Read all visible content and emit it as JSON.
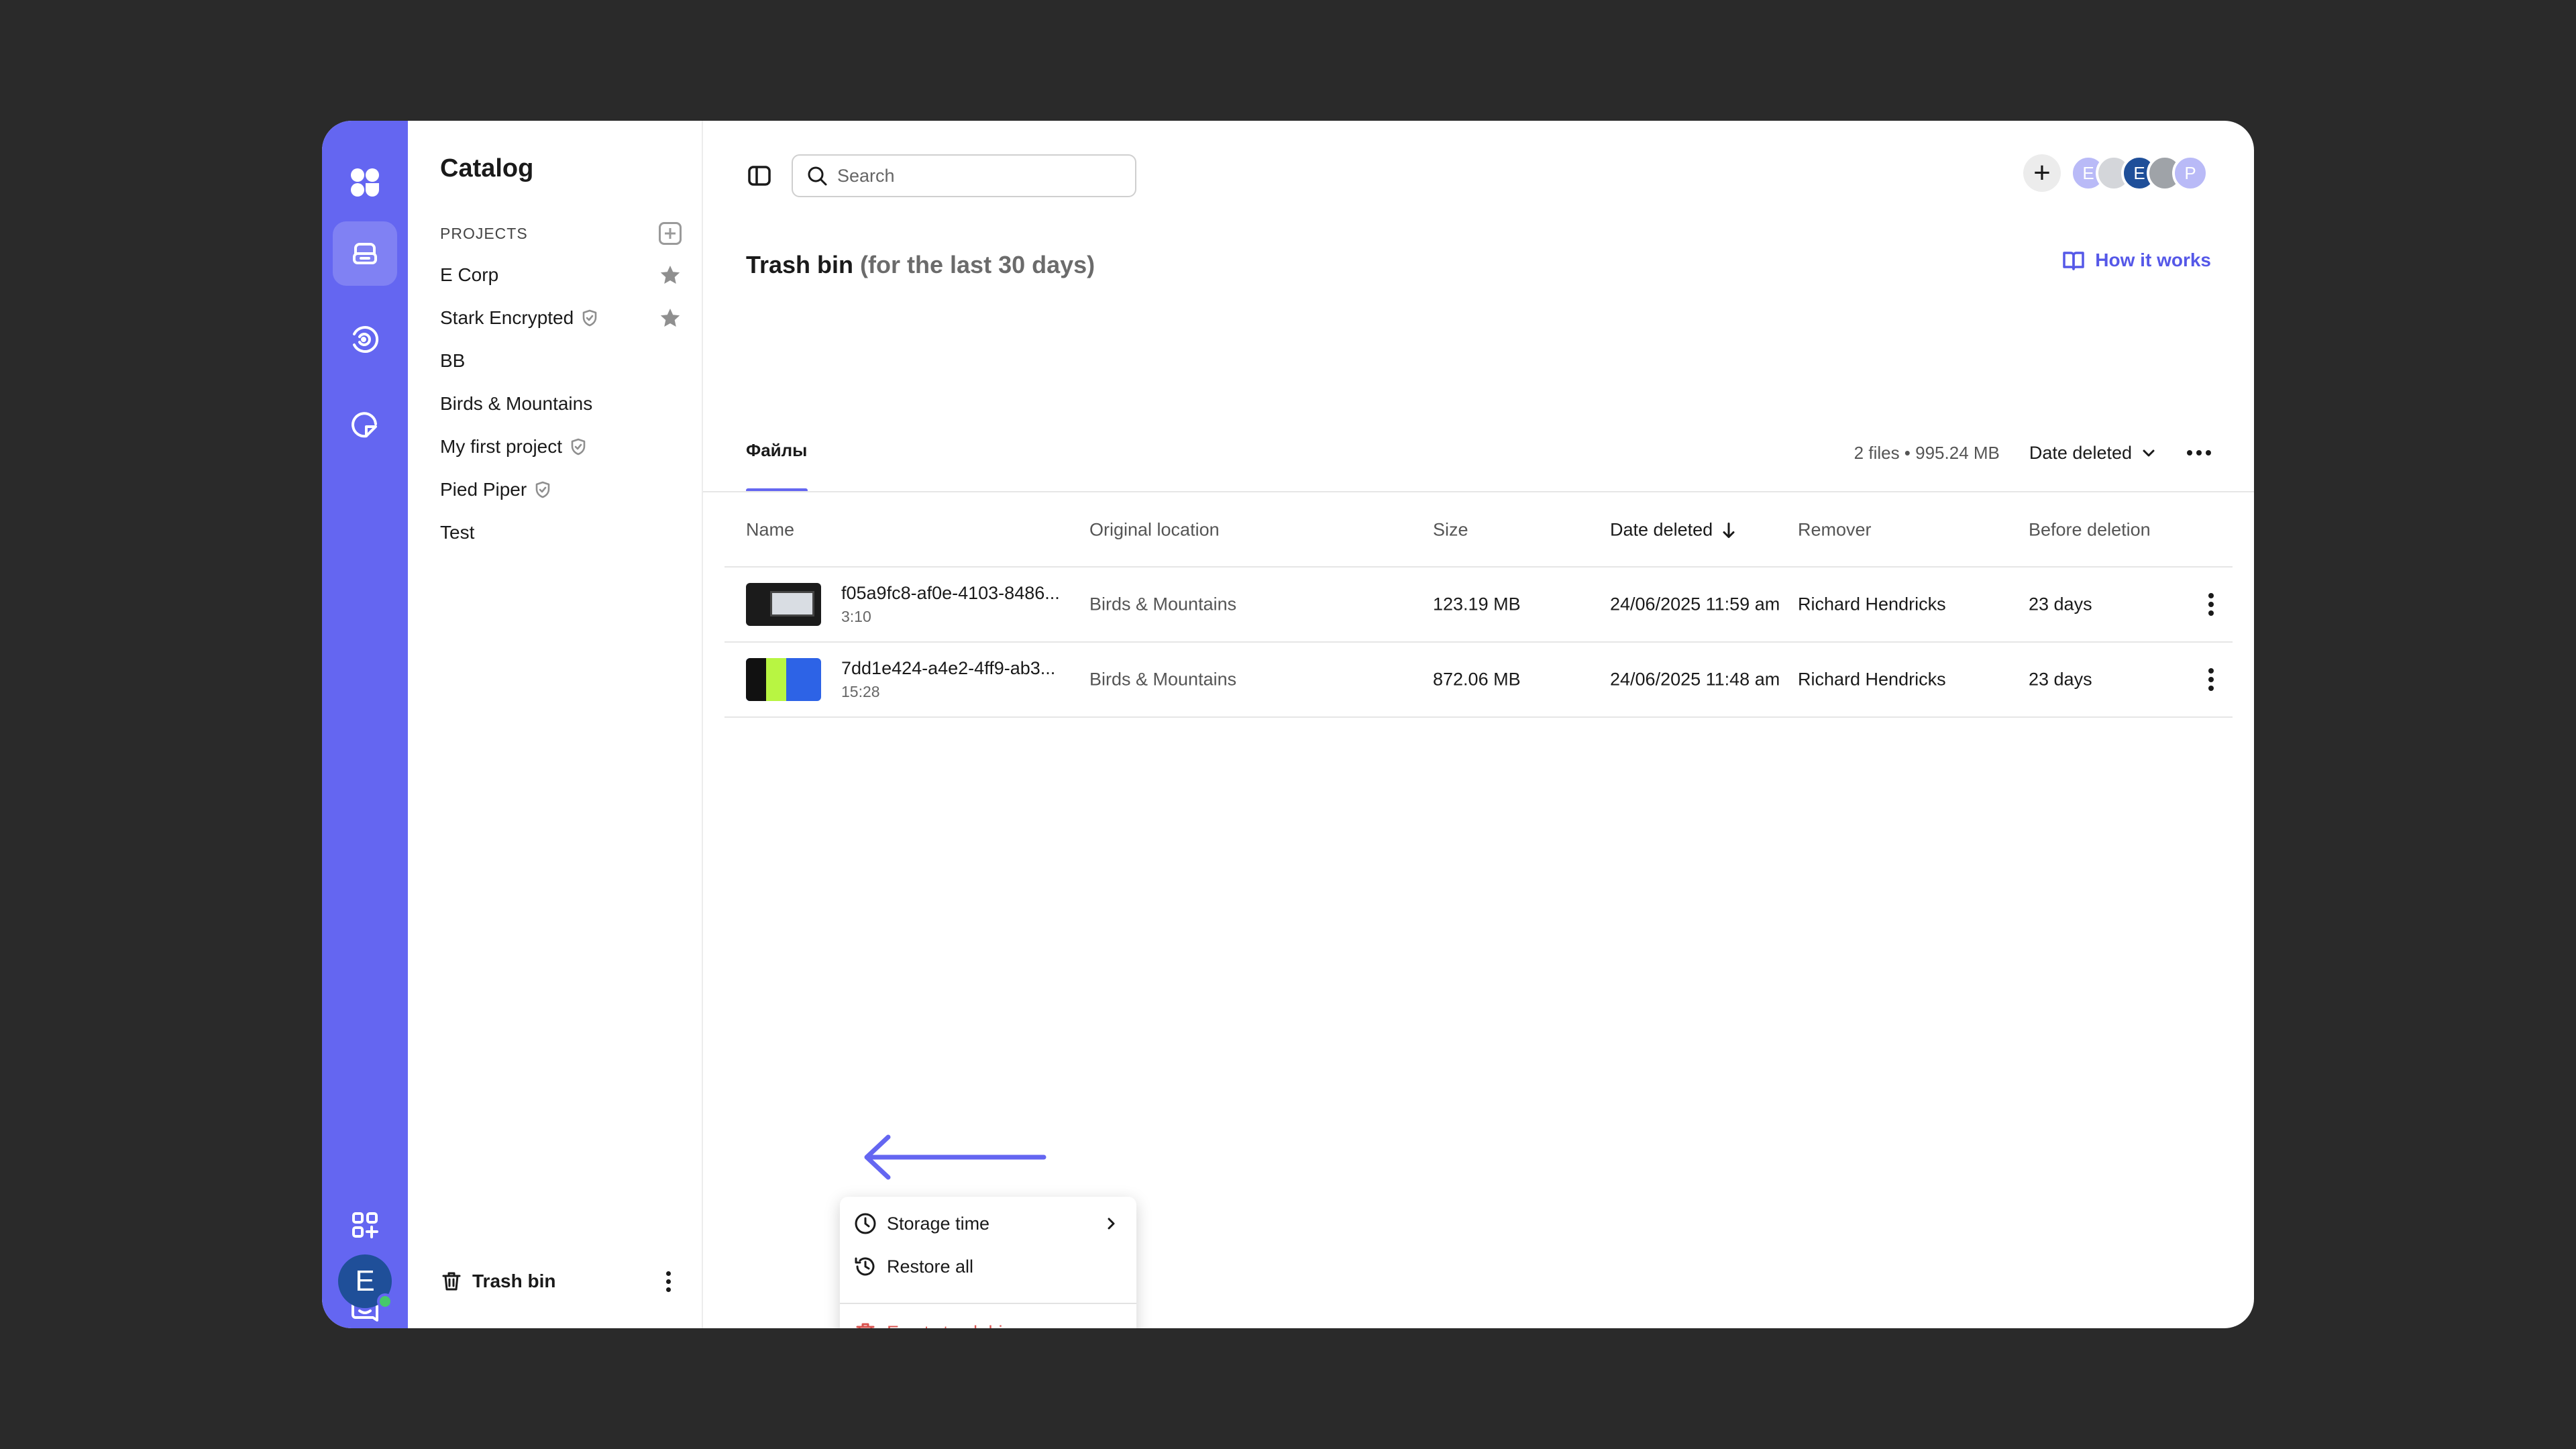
{
  "colors": {
    "accent": "#6466f1",
    "link": "#5558e8",
    "danger": "#d9534f",
    "backdrop": "#2a2a2a"
  },
  "rail": {
    "items": [
      {
        "name": "logo",
        "icon": "app-logo-icon"
      },
      {
        "name": "catalog",
        "icon": "storage-icon",
        "active": true
      },
      {
        "name": "broadcast",
        "icon": "stream-icon"
      },
      {
        "name": "review",
        "icon": "review-icon"
      },
      {
        "name": "apps",
        "icon": "apps-add-icon"
      },
      {
        "name": "messages",
        "icon": "chat-icon"
      }
    ],
    "avatar_letter": "E"
  },
  "catalog": {
    "title": "Catalog",
    "projects_label": "PROJECTS",
    "projects": [
      {
        "name": "E Corp",
        "starred": true,
        "shield": false
      },
      {
        "name": "Stark Encrypted",
        "starred": true,
        "shield": true
      },
      {
        "name": "BB",
        "starred": false,
        "shield": false
      },
      {
        "name": "Birds & Mountains",
        "starred": false,
        "shield": false
      },
      {
        "name": "My first project",
        "starred": false,
        "shield": true
      },
      {
        "name": "Pied Piper",
        "starred": false,
        "shield": true
      },
      {
        "name": "Test",
        "starred": false,
        "shield": false
      }
    ],
    "trash_label": "Trash bin"
  },
  "toolbar": {
    "search_placeholder": "Search",
    "avatars": [
      {
        "letter": "E",
        "color": "#b9baf7"
      },
      {
        "letter": "",
        "color": "#d4d6da"
      },
      {
        "letter": "E",
        "color": "#1f4f99"
      },
      {
        "letter": "",
        "color": "#9fa3a8"
      },
      {
        "letter": "P",
        "color": "#b9baf7"
      }
    ]
  },
  "page": {
    "title": "Trash bin",
    "subtitle": "(for the last 30 days)",
    "how_it_works": "How it works",
    "tab_files": "Файлы",
    "file_count": "2 files • 995.24 MB",
    "sort_label": "Date deleted"
  },
  "table": {
    "headers": {
      "name": "Name",
      "location": "Original location",
      "size": "Size",
      "date": "Date deleted",
      "remover": "Remover",
      "before": "Before deletion"
    },
    "rows": [
      {
        "name": "f05a9fc8-af0e-4103-8486...",
        "duration": "3:10",
        "location": "Birds & Mountains",
        "size": "123.19 MB",
        "date": "24/06/2025 11:59 am",
        "remover": "Richard Hendricks",
        "before": "23 days"
      },
      {
        "name": "7dd1e424-a4e2-4ff9-ab3...",
        "duration": "15:28",
        "location": "Birds & Mountains",
        "size": "872.06 MB",
        "date": "24/06/2025 11:48 am",
        "remover": "Richard Hendricks",
        "before": "23 days"
      }
    ]
  },
  "context_menu": {
    "storage_time": "Storage time",
    "restore_all": "Restore all",
    "empty_trash": "Empty trash bin"
  }
}
